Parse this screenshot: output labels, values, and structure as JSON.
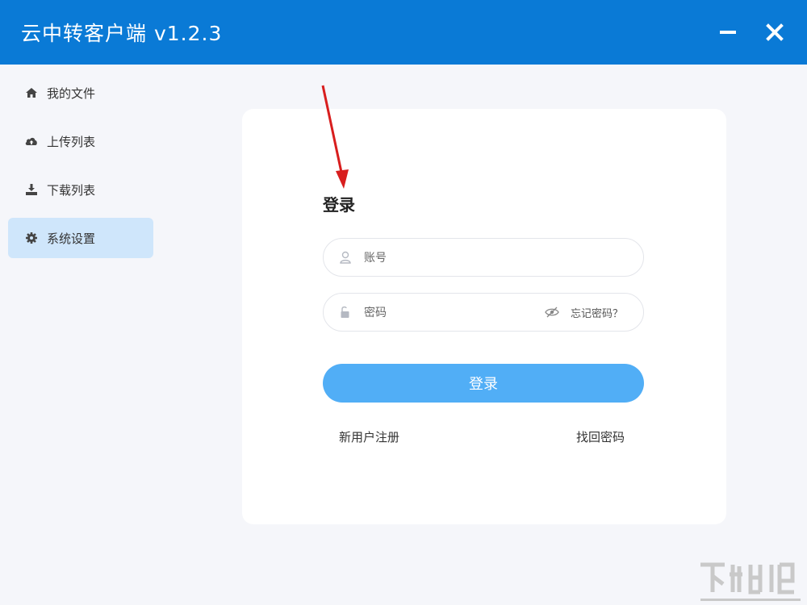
{
  "window": {
    "title": "云中转客户端 v1.2.3"
  },
  "sidebar": {
    "items": [
      {
        "label": "我的文件",
        "icon": "home-icon"
      },
      {
        "label": "上传列表",
        "icon": "cloud-upload-icon"
      },
      {
        "label": "下载列表",
        "icon": "download-icon"
      },
      {
        "label": "系统设置",
        "icon": "gear-icon",
        "active": true
      }
    ]
  },
  "login": {
    "title": "登录",
    "account_placeholder": "账号",
    "password_placeholder": "密码",
    "forgot_label": "忘记密码？",
    "submit_label": "登录",
    "register_label": "新用户注册",
    "recover_label": "找回密码"
  },
  "colors": {
    "titlebar": "#0a7ad6",
    "accent_button": "#51aef6",
    "active_item": "#cfe6fb",
    "annotation_arrow": "#d81e1e"
  }
}
